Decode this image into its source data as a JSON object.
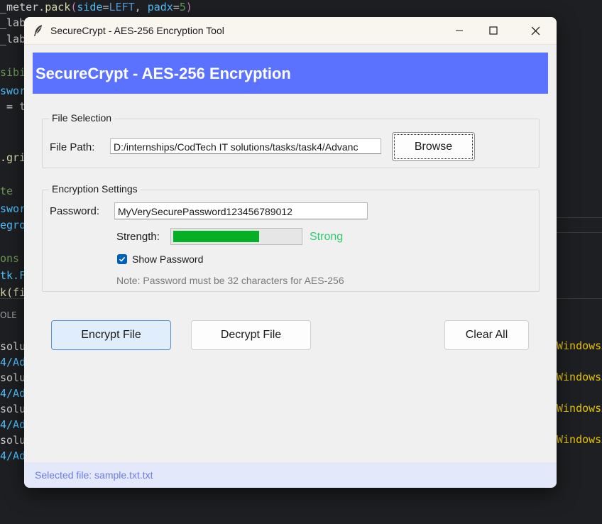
{
  "window": {
    "title": "SecureCrypt - AES-256 Encryption Tool",
    "header": "SecureCrypt - AES-256 Encryption"
  },
  "file_selection": {
    "group_label": "File Selection",
    "path_label": "File Path:",
    "path_value": "D:/internships/CodTech IT solutions/tasks/task4/Advanc",
    "browse_label": "Browse"
  },
  "encryption_settings": {
    "group_label": "Encryption Settings",
    "password_label": "Password:",
    "password_value": "MyVerySecurePassword123456789012",
    "strength_label": "Strength:",
    "strength_value": "Strong",
    "strength_fraction": 0.68,
    "strength_color": "#06b025",
    "show_password_label": "Show Password",
    "show_password_checked": true,
    "note": "Note: Password must be 32 characters for AES-256"
  },
  "actions": {
    "encrypt_label": "Encrypt File",
    "decrypt_label": "Decrypt File",
    "clear_label": "Clear All"
  },
  "status": {
    "text": "Selected file: sample.txt.txt"
  },
  "background_code": {
    "line1_a": "_meter.",
    "line1_b": "pack",
    "line1_c": "(",
    "line1_d": "side",
    "line1_e": "=",
    "line1_f": "LEFT",
    "line1_g": ", ",
    "line1_h": "padx",
    "line1_i": "=",
    "line1_j": "5",
    "line1_k": ")",
    "l2": "_lab",
    "l3": "_lab",
    "l4": "sibi",
    "l5": "swor",
    "l6": " = t",
    "l7": ".gri",
    "l8": "te",
    "l9": "swor",
    "l10": "egro",
    "l11": "ons",
    "l12": "tk.F",
    "l13": "k(fi",
    "l14": "OLE",
    "out1": "solu",
    "out2": "4/Ad",
    "out3": "solu",
    "out4": "4/Ad",
    "out5": "solu",
    "out6": "4/Ad",
    "out7": "solu",
    "out8": "4/Ad",
    "right1": "WindowsA",
    "right2": "WindowsA",
    "right3": "WindowsA",
    "right4": "WindowsA"
  }
}
